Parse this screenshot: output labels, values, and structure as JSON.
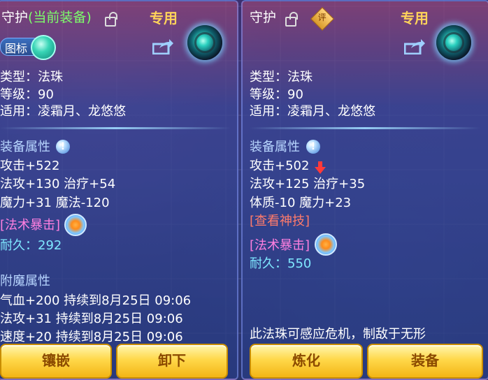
{
  "left_panel": {
    "title_prefix": "守护",
    "title_current": "(当前装备)",
    "exclusive_label": "专用",
    "icon_toggle_label": "图标",
    "type_line": "类型：法珠",
    "level_line": "等级：90",
    "usage_line": "适用：凌霜月、龙悠悠",
    "equip_attr_label": "装备属性",
    "attack_line": "攻击+522",
    "magatk_heal_line": "法攻+130 治疗+54",
    "mana_magic_line": "魔力+31 魔法-120",
    "spell_crit_label": "[法术暴击]",
    "durability_label": "耐久：",
    "durability_value": "292",
    "enchant_label": "附魔属性",
    "enchant_lines": [
      "气血+200 持续到8月25日 09:06",
      "法攻+31 持续到8月25日 09:06",
      "速度+20 持续到8月25日 09:06"
    ],
    "buttons": {
      "inlay": "镶嵌",
      "unequip": "卸下"
    }
  },
  "right_panel": {
    "title_prefix": "守护",
    "rating_badge": "评",
    "exclusive_label": "专用",
    "type_line": "类型：法珠",
    "level_line": "等级：90",
    "usage_line": "适用：凌霜月、龙悠悠",
    "equip_attr_label": "装备属性",
    "attack_line": "攻击+502",
    "magatk_heal_line": "法攻+125 治疗+35",
    "con_mana_line": "体质-10 魔力+23",
    "check_skill_label": "[查看神技]",
    "spell_crit_label": "[法术暴击]",
    "durability_label": "耐久：",
    "durability_value": "550",
    "description": "此法珠可感应危机，制敌于无形",
    "buttons": {
      "refine": "炼化",
      "equip": "装备"
    }
  },
  "colors": {
    "title_white": "#ffffff",
    "current_green": "#7dff6b",
    "exclusive_gold": "#ffd35a",
    "section_blue": "#b8d6ff",
    "spell_pink": "#ff7fe0",
    "skill_red": "#ff7b6b",
    "durability_cyan": "#7fe8ff",
    "button_gold": "#ffd84a"
  },
  "icons": [
    "lock-icon",
    "share-icon",
    "orb-gem-icon",
    "info-icon",
    "swirl-icon",
    "down-arrow-icon",
    "rating-badge-icon"
  ]
}
